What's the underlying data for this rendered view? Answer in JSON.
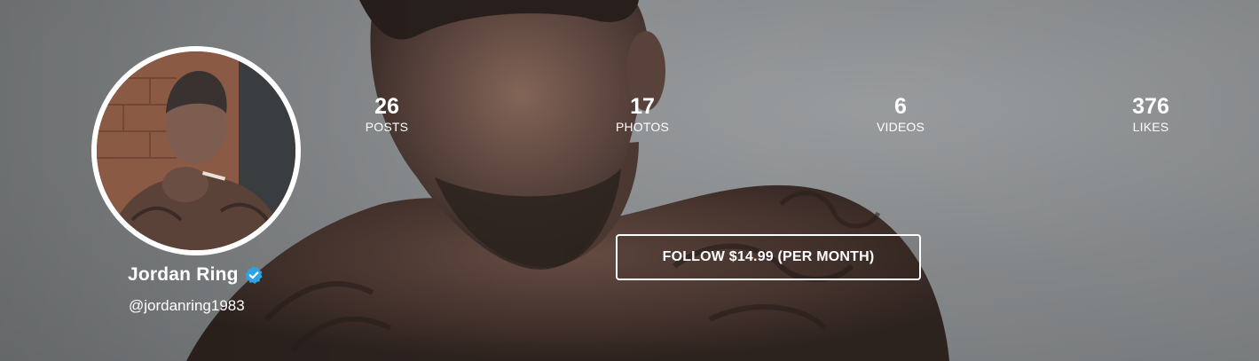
{
  "profile": {
    "name": "Jordan Ring",
    "handle": "@jordanring1983",
    "verified": true,
    "verified_color": "#2fa2e6"
  },
  "stats": {
    "posts": {
      "value": "26",
      "label": "POSTS"
    },
    "photos": {
      "value": "17",
      "label": "PHOTOS"
    },
    "videos": {
      "value": "6",
      "label": "VIDEOS"
    },
    "likes": {
      "value": "376",
      "label": "LIKES"
    }
  },
  "follow": {
    "label": "FOLLOW $14.99 (PER MONTH)"
  },
  "icons": {
    "verified": "verified-check-icon"
  }
}
